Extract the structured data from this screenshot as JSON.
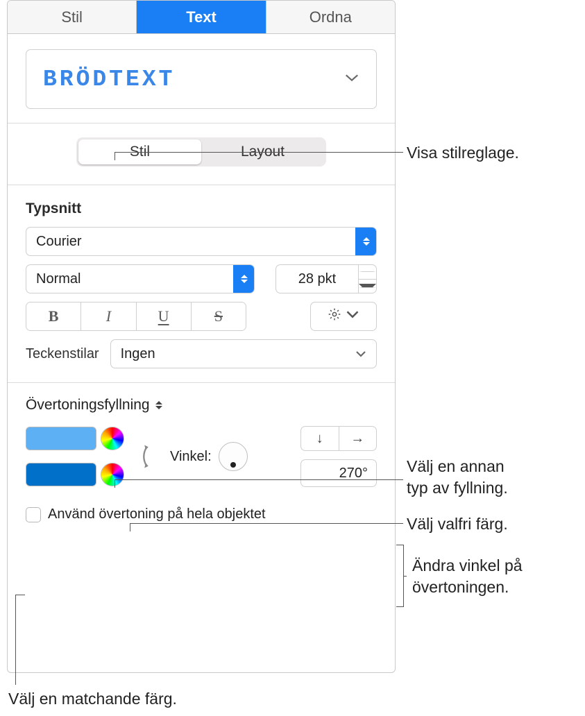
{
  "top_tabs": {
    "stil": "Stil",
    "text": "Text",
    "ordna": "Ordna"
  },
  "paragraph_style": "Brödtext",
  "sub_tabs": {
    "stil": "Stil",
    "layout": "Layout"
  },
  "font_section_label": "Typsnitt",
  "font_family": "Courier",
  "font_weight": "Normal",
  "font_size": "28 pkt",
  "bius": {
    "b": "B",
    "i": "I",
    "u": "U",
    "s": "S"
  },
  "char_styles_label": "Teckenstilar",
  "char_styles_value": "Ingen",
  "fill_type": "Övertoningsfyllning",
  "angle_label": "Vinkel:",
  "angle_value": "270°",
  "apply_whole_label": "Använd övertoning på hela objektet",
  "callouts": {
    "c1": "Visa stilreglage.",
    "c2a": "Välj en annan",
    "c2b": "typ av fyllning.",
    "c3": "Välj valfri färg.",
    "c4a": "Ändra vinkel på",
    "c4b": "övertoningen.",
    "c5": "Välj en matchande färg."
  }
}
